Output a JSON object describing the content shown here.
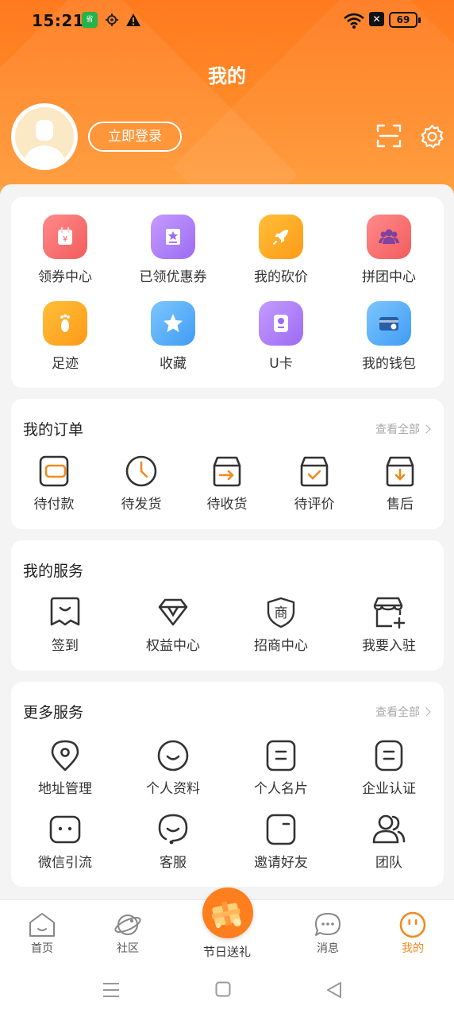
{
  "status_bar": {
    "time": "15:21",
    "battery": "69",
    "app_icon_text": "省",
    "icons": [
      "app-icon",
      "location-icon",
      "warning-icon",
      "wifi-icon",
      "close-box-icon",
      "battery-icon"
    ]
  },
  "header": {
    "title": "我的",
    "login_label": "立即登录",
    "colors": {
      "primary": "#ff7a1e",
      "accent": "#f28a1f"
    }
  },
  "quick_menu": [
    {
      "label": "领券中心",
      "icon": "coupon-center-icon",
      "color": "#f25c5c"
    },
    {
      "label": "已领优惠券",
      "icon": "received-coupon-icon",
      "color": "#9c6bf2"
    },
    {
      "label": "我的砍价",
      "icon": "rocket-icon",
      "color": "#ff9a17"
    },
    {
      "label": "拼团中心",
      "icon": "group-buy-icon",
      "color": "#f25c5c"
    },
    {
      "label": "足迹",
      "icon": "footprint-icon",
      "color": "#ff9a17"
    },
    {
      "label": "收藏",
      "icon": "star-icon",
      "color": "#3f9cf3"
    },
    {
      "label": "U卡",
      "icon": "user-card-icon",
      "color": "#9c6bf2"
    },
    {
      "label": "我的钱包",
      "icon": "wallet-icon",
      "color": "#3f9cf3"
    }
  ],
  "orders": {
    "title": "我的订单",
    "view_all": "查看全部",
    "items": [
      {
        "label": "待付款",
        "icon": "pending-payment-icon"
      },
      {
        "label": "待发货",
        "icon": "pending-shipment-icon"
      },
      {
        "label": "待收货",
        "icon": "pending-receipt-icon"
      },
      {
        "label": "待评价",
        "icon": "pending-review-icon"
      },
      {
        "label": "售后",
        "icon": "after-sales-icon"
      }
    ]
  },
  "services": {
    "title": "我的服务",
    "items": [
      {
        "label": "签到",
        "icon": "checkin-icon"
      },
      {
        "label": "权益中心",
        "icon": "diamond-icon"
      },
      {
        "label": "招商中心",
        "icon": "merchant-shield-icon"
      },
      {
        "label": "我要入驻",
        "icon": "store-add-icon"
      }
    ]
  },
  "more_services": {
    "title": "更多服务",
    "view_all": "查看全部",
    "items": [
      {
        "label": "地址管理",
        "icon": "location-pin-icon"
      },
      {
        "label": "个人资料",
        "icon": "smile-icon"
      },
      {
        "label": "个人名片",
        "icon": "card-icon"
      },
      {
        "label": "企业认证",
        "icon": "certificate-icon"
      },
      {
        "label": "微信引流",
        "icon": "wechat-face-icon"
      },
      {
        "label": "客服",
        "icon": "customer-service-icon"
      },
      {
        "label": "邀请好友",
        "icon": "invite-icon"
      },
      {
        "label": "团队",
        "icon": "team-icon"
      }
    ]
  },
  "bottom_nav": {
    "items": [
      {
        "label": "首页",
        "icon": "home-icon"
      },
      {
        "label": "社区",
        "icon": "planet-icon"
      },
      {
        "label": "节日送礼",
        "icon": "gift-icon"
      },
      {
        "label": "消息",
        "icon": "message-icon"
      },
      {
        "label": "我的",
        "icon": "profile-face-icon",
        "active": true
      }
    ]
  }
}
